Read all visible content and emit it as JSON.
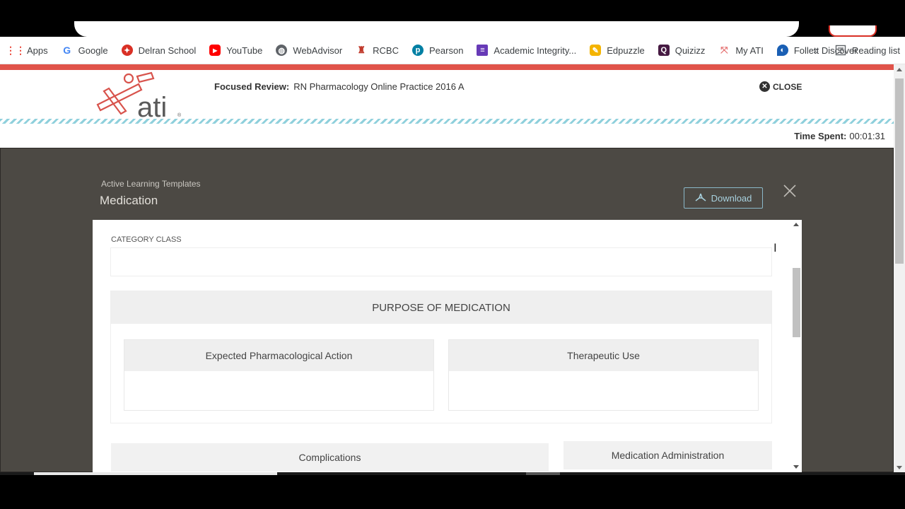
{
  "bookmarks": [
    {
      "label": "Apps",
      "icon": "apps-grid-icon",
      "color": "#ea4335"
    },
    {
      "label": "Google",
      "icon": "google-icon",
      "color": "#4285f4"
    },
    {
      "label": "Delran School",
      "icon": "delran-school-icon",
      "color": "#d93025"
    },
    {
      "label": "YouTube",
      "icon": "youtube-icon",
      "color": "#ff0000"
    },
    {
      "label": "WebAdvisor",
      "icon": "globe-icon",
      "color": "#5f6368"
    },
    {
      "label": "RCBC",
      "icon": "rcbc-icon",
      "color": "#c0392b"
    },
    {
      "label": "Pearson",
      "icon": "pearson-icon",
      "color": "#007fa3"
    },
    {
      "label": "Academic Integrity...",
      "icon": "forms-icon",
      "color": "#673ab7"
    },
    {
      "label": "Edpuzzle",
      "icon": "edpuzzle-icon",
      "color": "#f4b400"
    },
    {
      "label": "Quizizz",
      "icon": "quizizz-icon",
      "color": "#461a42"
    },
    {
      "label": "My ATI",
      "icon": "ati-icon",
      "color": "#e57373"
    },
    {
      "label": "Follett Discover",
      "icon": "follett-icon",
      "color": "#1a5fb4"
    }
  ],
  "bookmarks_more": "»",
  "reading_list": "Reading list",
  "header": {
    "focused_label": "Focused Review:",
    "focused_value": "RN Pharmacology Online Practice 2016 A",
    "close_label": "CLOSE",
    "time_label": "Time Spent:",
    "time_value": "00:01:31"
  },
  "modal": {
    "breadcrumb": "Active Learning Templates",
    "title": "Medication",
    "download_label": "Download",
    "category_label": "CATEGORY CLASS",
    "purpose_heading": "PURPOSE OF MEDICATION",
    "expected_action": "Expected Pharmacological Action",
    "therapeutic_use": "Therapeutic Use",
    "complications": "Complications",
    "med_admin": "Medication Administration"
  },
  "colors": {
    "accent_red": "#e0534a",
    "stripe": "#8fd0dc",
    "overlay": "#4c4944",
    "download": "#a8d1df"
  }
}
